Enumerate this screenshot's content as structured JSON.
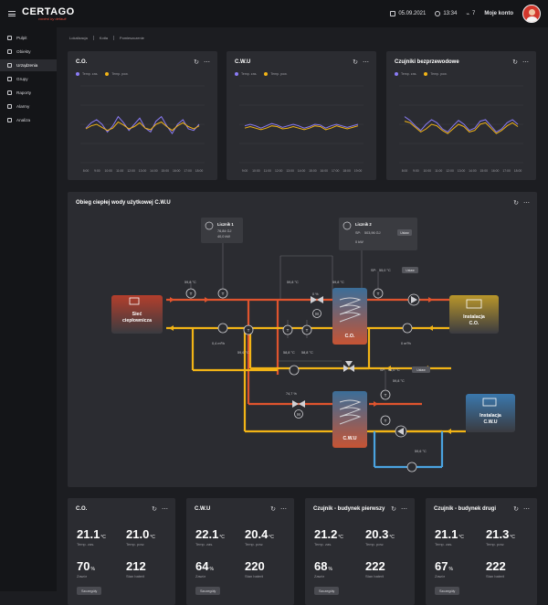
{
  "topbar": {
    "logo": "CERTAGO",
    "logo_tagline": "control by default",
    "date": "05.09.2021",
    "time": "13:34",
    "alarm_count": "7",
    "account_label": "Moje konto"
  },
  "sidebar": {
    "items": [
      {
        "label": "Pulpit",
        "icon": "dashboard-icon"
      },
      {
        "label": "Obiekty",
        "icon": "building-icon"
      },
      {
        "label": "Urządzenia",
        "icon": "device-icon"
      },
      {
        "label": "Grupy",
        "icon": "group-icon"
      },
      {
        "label": "Raporty",
        "icon": "report-icon"
      },
      {
        "label": "Alarmy",
        "icon": "bell-icon"
      },
      {
        "label": "Analiza",
        "icon": "analysis-icon"
      }
    ]
  },
  "breadcrumb": [
    "Lokalizacja",
    "Kotła",
    "Pomieszczenie"
  ],
  "colors": {
    "series_a": "#8b7cf6",
    "series_b": "#f2b416",
    "hot_pipe": "#e0542e",
    "cold_pipe": "#f2b416",
    "blue_pipe": "#4aa3e0"
  },
  "charts": {
    "legend_a": "Temp. zas.",
    "legend_b": "Temp. pow.",
    "cards": [
      {
        "title": "C.O.",
        "x_ticks": [
          "8:00",
          "9:00",
          "10:00",
          "11:00",
          "12:00",
          "13:00",
          "14:00",
          "15:00",
          "16:00",
          "17:00",
          "18:00"
        ]
      },
      {
        "title": "C.W.U",
        "x_ticks": [
          "9:00",
          "10:00",
          "11:00",
          "12:00",
          "13:00",
          "14:00",
          "15:00",
          "16:00",
          "17:00",
          "18:00",
          "19:00"
        ]
      },
      {
        "title": "Czujniki bezprzewodowe",
        "x_ticks": [
          "8:00",
          "9:00",
          "10:00",
          "11:00",
          "12:00",
          "13:00",
          "14:00",
          "15:00",
          "16:00",
          "17:00",
          "18:00"
        ]
      }
    ]
  },
  "diagram": {
    "title": "Obieg ciepłej wody użytkowej C.W.U",
    "meter1": {
      "title": "Licznik 1",
      "line1": "76,84 GJ",
      "line2": "40,0 kW"
    },
    "meter2": {
      "title": "Licznik 2",
      "sp_label": "SP:",
      "sp_value": "503,96 GJ",
      "line2": "0 kW",
      "button": "Ustaw"
    },
    "sp2": {
      "label": "SP:",
      "value": "55,0 °C",
      "button": "Ustaw"
    },
    "sp3": {
      "label": "SP:",
      "value": "55,0 °C",
      "button": "Ustaw"
    },
    "left_device": {
      "line1": "Sieć",
      "line2": "ciepłownicza"
    },
    "right_device1": {
      "line1": "Instalacja",
      "line2": "C.O."
    },
    "right_device2": {
      "line1": "Instalacja",
      "line2": "C.W.U"
    },
    "tank1": "C.O.",
    "tank2": "C.W.U",
    "labels": {
      "t_left_top": "59,8 °C",
      "t_mid_top": "59,8 °C",
      "t_right_top": "59,8 °C",
      "valve_pct": "0 %",
      "flow_left": "0,4 m³/h",
      "t_bottom_left": "59,6 °C",
      "t_bottom_mid1": "58,8 °C",
      "t_bottom_mid2": "58,8 °C",
      "flow_right": "0 m³/h",
      "t_sp3_below": "59,8 °C",
      "valve2_pct": "74,7 %",
      "t_cwu_return": "59,6 °C"
    }
  },
  "stats": [
    {
      "title": "C.O.",
      "v1": "21.1",
      "u1": "°C",
      "c1": "Temp. zas.",
      "v2": "21.0",
      "u2": "°C",
      "c2": "Temp. pow.",
      "v3": "70",
      "u3": "%",
      "c3": "Zawór",
      "v4": "212",
      "c4": "Stan baterii",
      "button": "Szczegóły"
    },
    {
      "title": "C.W.U",
      "v1": "22.1",
      "u1": "°C",
      "c1": "Temp. zas.",
      "v2": "20.4",
      "u2": "°C",
      "c2": "Temp. pow.",
      "v3": "64",
      "u3": "%",
      "c3": "Zawór",
      "v4": "220",
      "c4": "Stan baterii",
      "button": "Szczegóły"
    },
    {
      "title": "Czujnik - budynek pierwszy",
      "v1": "21.2",
      "u1": "°C",
      "c1": "Temp. zas.",
      "v2": "20.3",
      "u2": "°C",
      "c2": "Temp. pow.",
      "v3": "68",
      "u3": "%",
      "c3": "Zawór",
      "v4": "222",
      "c4": "Stan baterii",
      "button": "Szczegóły"
    },
    {
      "title": "Czujnik - budynek drugi",
      "v1": "21.1",
      "u1": "°C",
      "c1": "Temp. zas.",
      "v2": "21.3",
      "u2": "°C",
      "c2": "Temp. pow.",
      "v3": "67",
      "u3": "%",
      "c3": "Zawór",
      "v4": "222",
      "c4": "Stan baterii",
      "button": "Szczegóły"
    }
  ]
}
